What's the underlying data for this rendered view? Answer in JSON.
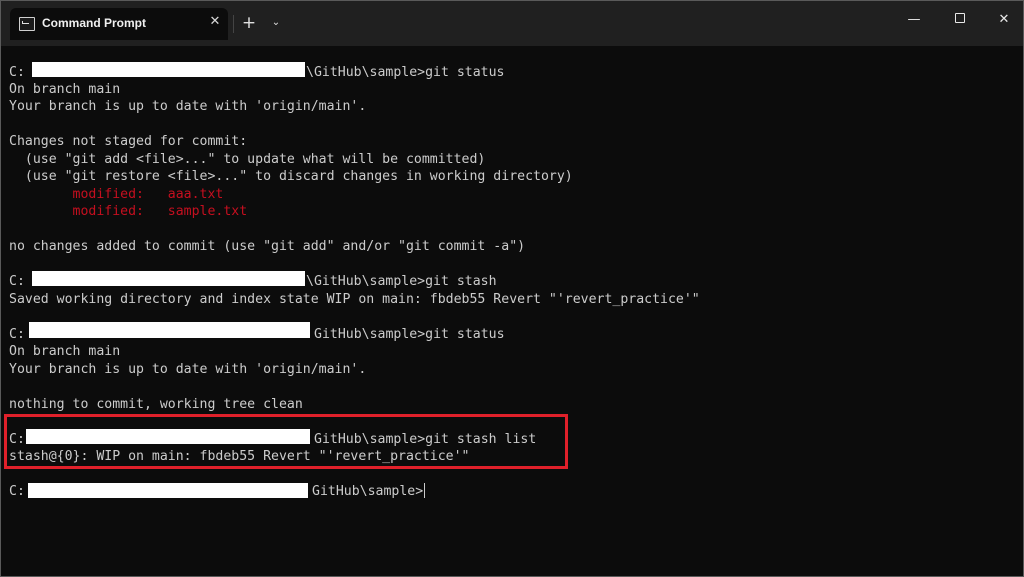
{
  "titlebar": {
    "tab_title": "Command Prompt",
    "close_tab": "✕",
    "new_tab": "+",
    "dropdown": "⌄",
    "minimize": "—",
    "close": "✕"
  },
  "terminal": {
    "cmd1_prefix": "C:",
    "cmd1_suffix": "\\GitHub\\sample>git status",
    "l_on_branch_1": "On branch main",
    "l_uptodate_1": "Your branch is up to date with 'origin/main'.",
    "l_changes": "Changes not staged for commit:",
    "l_hint_add": "  (use \"git add <file>...\" to update what will be committed)",
    "l_hint_restore": "  (use \"git restore <file>...\" to discard changes in working directory)",
    "l_mod1": "        modified:   aaa.txt",
    "l_mod2": "        modified:   sample.txt",
    "l_nochanges": "no changes added to commit (use \"git add\" and/or \"git commit -a\")",
    "cmd2_prefix": "C:",
    "cmd2_suffix": "\\GitHub\\sample>git stash",
    "l_saved": "Saved working directory and index state WIP on main: fbdeb55 Revert \"'revert_practice'\"",
    "cmd3_prefix": "C:",
    "cmd3_suffix": "GitHub\\sample>git status",
    "l_on_branch_2": "On branch main",
    "l_uptodate_2": "Your branch is up to date with 'origin/main'.",
    "l_clean": "nothing to commit, working tree clean",
    "cmd4_prefix": "C:",
    "cmd4_suffix": "GitHub\\sample>git stash list",
    "l_stash": "stash@{0}: WIP on main: fbdeb55 Revert \"'revert_practice'\"",
    "cmd5_prefix": "C:",
    "cmd5_suffix": "GitHub\\sample>"
  },
  "colors": {
    "background": "#0c0c0c",
    "text": "#cccccc",
    "modified": "#c50f1f",
    "highlight": "#e0202a"
  }
}
